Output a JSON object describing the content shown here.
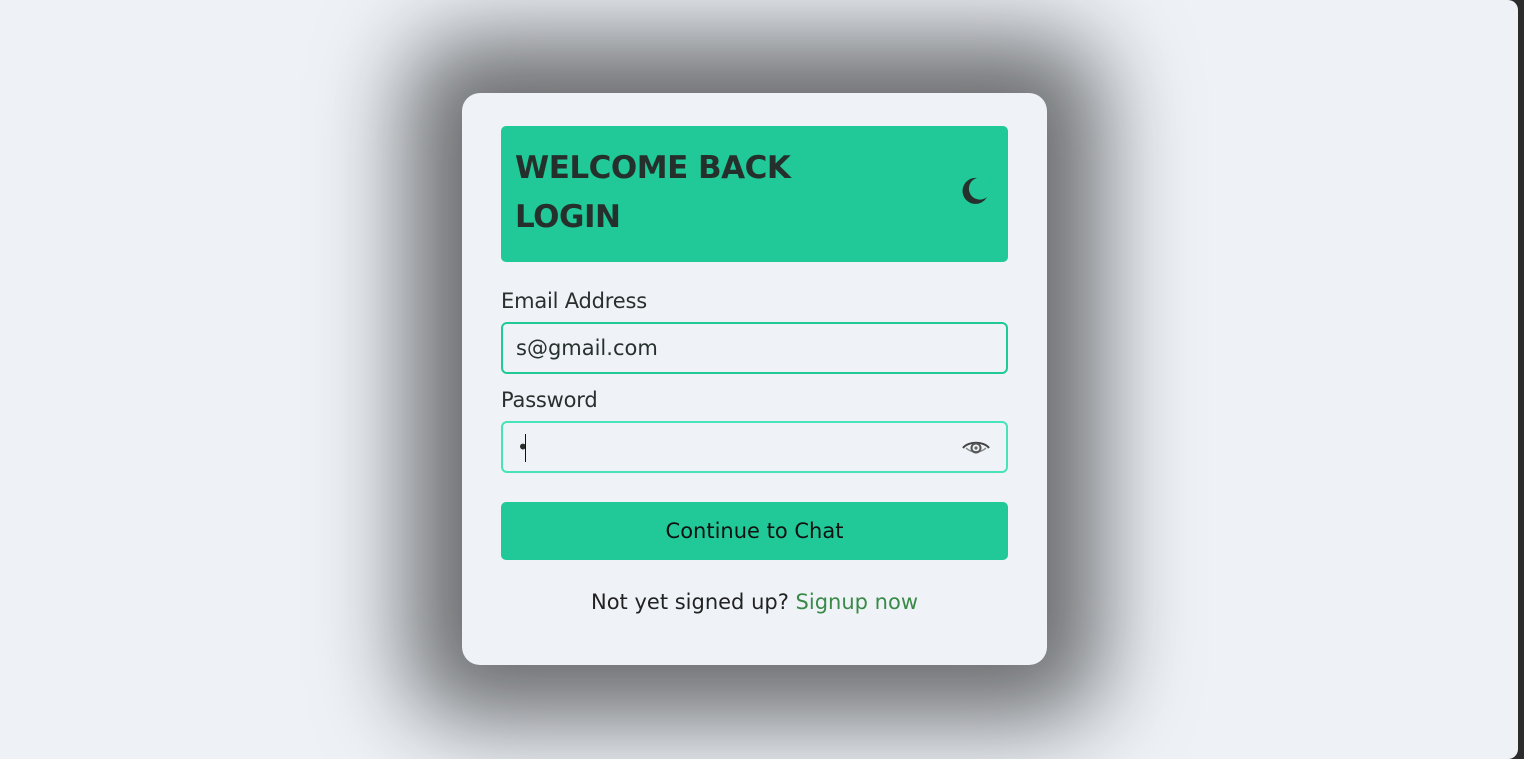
{
  "login_card": {
    "header": {
      "title_line_1": "WELCOME BACK",
      "title_line_2": "LOGIN",
      "theme_icon": "moon-icon"
    },
    "email": {
      "label": "Email Address",
      "value": "s@gmail.com"
    },
    "password": {
      "label": "Password",
      "masked_value": "•",
      "visibility_icon": "eye-icon"
    },
    "submit_label": "Continue to Chat",
    "footer": {
      "prompt": "Not yet signed up?",
      "signup_link": "Signup now"
    }
  },
  "colors": {
    "accent": "#20c997",
    "background": "#eef2f7",
    "link": "#3a8a47",
    "text": "#2a2f2d"
  }
}
